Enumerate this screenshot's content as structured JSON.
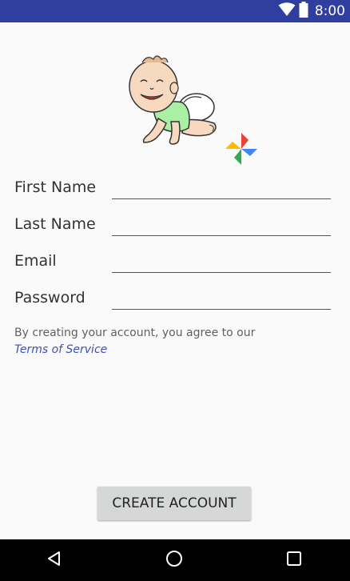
{
  "status_bar": {
    "time": "8:00",
    "icons": [
      "wifi-icon",
      "battery-icon"
    ],
    "color": "#303f9f"
  },
  "logo": {
    "icons": [
      "baby-icon",
      "pinwheel-icon"
    ]
  },
  "form": {
    "fields": [
      {
        "label": "First Name",
        "value": "",
        "placeholder": ""
      },
      {
        "label": "Last Name",
        "value": "",
        "placeholder": ""
      },
      {
        "label": "Email",
        "value": "",
        "placeholder": ""
      },
      {
        "label": "Password",
        "value": "",
        "placeholder": ""
      }
    ]
  },
  "terms": {
    "text": "By creating your account, you agree to our",
    "link": "Terms of Service",
    "link_color": "#3f51b5"
  },
  "create_button": {
    "label": "CREATE ACCOUNT"
  },
  "nav_bar": {
    "icons": [
      "back-icon",
      "home-icon",
      "recents-icon"
    ]
  }
}
